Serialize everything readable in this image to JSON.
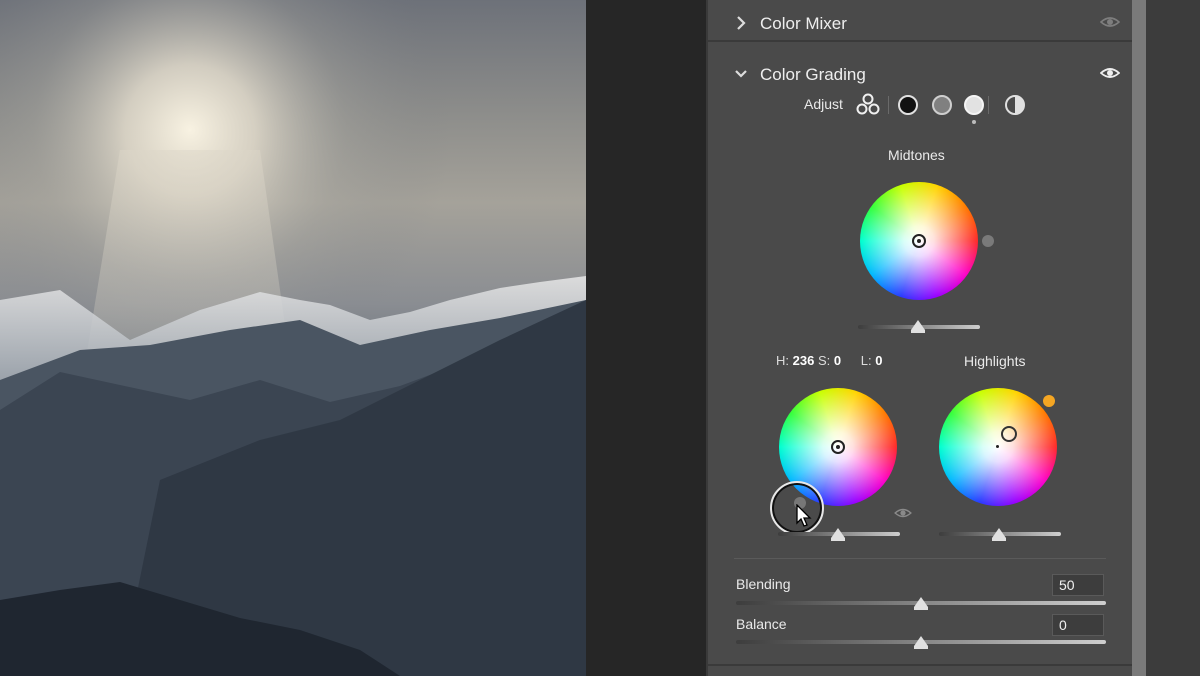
{
  "panel": {
    "sections": {
      "color_mixer": {
        "title": "Color Mixer",
        "expanded": false
      },
      "color_grading": {
        "title": "Color Grading",
        "expanded": true
      }
    },
    "adjust": {
      "label": "Adjust",
      "selected_mode": "highlights",
      "modes": [
        "3-way-icon",
        "shadows-circle-icon",
        "midtones-circle-icon",
        "highlights-circle-icon",
        "global-half-circle-icon"
      ]
    },
    "midtones": {
      "title": "Midtones"
    },
    "shadows_readout": {
      "h_label": "H:",
      "h_value": "236",
      "s_label": "S:",
      "s_value": "0",
      "l_label": "L:",
      "l_value": "0"
    },
    "highlights": {
      "title": "Highlights",
      "indicator_color": "#f5a623"
    },
    "blending": {
      "label": "Blending",
      "value": "50",
      "fraction": 0.5
    },
    "balance": {
      "label": "Balance",
      "value": "0",
      "fraction": 0.5
    }
  },
  "colors": {
    "panel_bg": "#4a4a4a",
    "accent_orange": "#f5a623"
  }
}
